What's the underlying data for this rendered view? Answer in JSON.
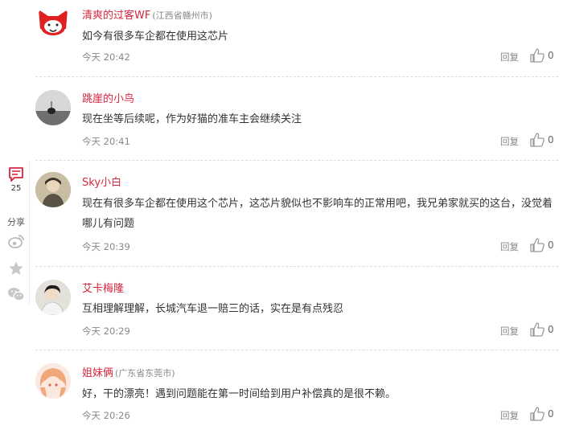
{
  "sidebar": {
    "comment_icon": "comment-icon",
    "comment_count": "25",
    "share_label": "分享",
    "share_icons": [
      "weibo-icon",
      "star-icon",
      "wechat-icon"
    ]
  },
  "comments": [
    {
      "name": "清爽的过客WF",
      "location": "(江西省赣州市)",
      "text": "如今有很多车企都在使用这芯片",
      "time": "今天 20:42",
      "reply_label": "回复",
      "likes": "0"
    },
    {
      "name": "跳崖的小鸟",
      "location": "",
      "text": "现在坐等后续呢，作为好猫的准车主会继续关注",
      "time": "今天 20:41",
      "reply_label": "回复",
      "likes": "0"
    },
    {
      "name": "Sky小白",
      "location": "",
      "text": "现在有很多车企都在使用这个芯片，这芯片貌似也不影响车的正常用吧，我兄弟家就买的这台，没觉着哪儿有问题",
      "time": "今天 20:39",
      "reply_label": "回复",
      "likes": "0"
    },
    {
      "name": "艾卡梅隆",
      "location": "",
      "text": "互相理解理解，长城汽车退一赔三的话，实在是有点残忍",
      "time": "今天 20:29",
      "reply_label": "回复",
      "likes": "0"
    },
    {
      "name": "姐妹俩",
      "location": "(广东省东莞市)",
      "text": "好，干的漂亮！遇到问题能在第一时间给到用户补偿真的是很不赖。",
      "time": "今天 20:26",
      "reply_label": "回复",
      "likes": "0"
    }
  ],
  "colors": {
    "name": "#d7263d",
    "muted": "#888888",
    "accent": "#d7263d"
  }
}
